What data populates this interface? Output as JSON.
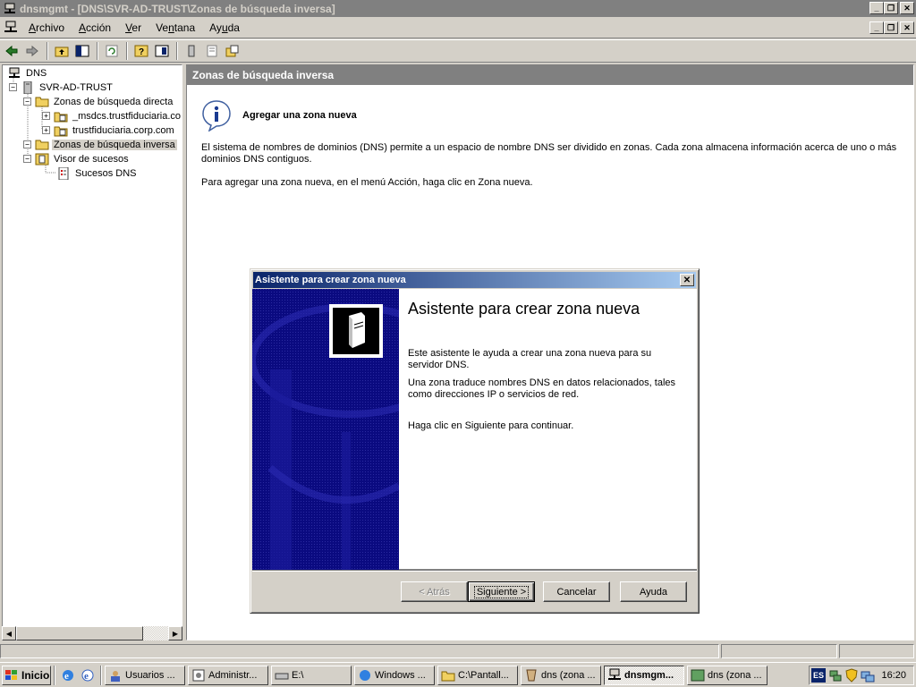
{
  "window": {
    "title": "dnsmgmt - [DNS\\SVR-AD-TRUST\\Zonas de búsqueda inversa]",
    "buttons": [
      "_",
      "❐",
      "✕"
    ]
  },
  "menu": {
    "items": [
      {
        "first": "A",
        "rest": "rchivo"
      },
      {
        "first": "A",
        "rest": "cción"
      },
      {
        "first": "V",
        "rest": "er"
      },
      {
        "first": "Ve",
        "rest": "ntana"
      },
      {
        "first": "Ay",
        "rest": "uda"
      }
    ]
  },
  "tree": {
    "root": "DNS",
    "server": "SVR-AD-TRUST",
    "forward_zones": "Zonas de búsqueda directa",
    "zone1": "_msdcs.trustfiduciaria.co",
    "zone2": "trustfiduciaria.corp.com",
    "reverse_zones": "Zonas de búsqueda inversa",
    "event_viewer": "Visor de sucesos",
    "dns_events": "Sucesos DNS",
    "expanders": [
      "−",
      "−",
      "+",
      "+",
      "−",
      "−"
    ]
  },
  "right_pane": {
    "header": "Zonas de búsqueda inversa",
    "info_title": "Agregar una zona nueva",
    "para1": "El sistema de nombres de dominios (DNS) permite a un espacio de nombre DNS ser dividido en zonas. Cada zona almacena información acerca de uno o más dominios DNS contiguos.",
    "para2": "Para agregar una zona nueva, en el menú Acción, haga clic en Zona nueva."
  },
  "dialog": {
    "title": "Asistente para crear zona nueva",
    "close": "✕",
    "heading": "Asistente para crear zona nueva",
    "text1": "Este asistente le ayuda a crear una zona nueva para su servidor DNS.",
    "text2": "Una zona traduce nombres DNS en datos relacionados, tales como direcciones IP o servicios de red.",
    "text3": "Haga clic en Siguiente para continuar.",
    "btn_back": "< Atrás",
    "btn_next": "Siguiente >",
    "btn_cancel": "Cancelar",
    "btn_help": "Ayuda"
  },
  "taskbar": {
    "start": "Inicio",
    "tasks": [
      "Usuarios ...",
      "Administr...",
      "E:\\",
      "Windows ...",
      "C:\\Pantall...",
      "dns (zona ...",
      "dnsmgm...",
      "dns (zona ..."
    ],
    "lang": "ES",
    "clock": "16:20"
  }
}
